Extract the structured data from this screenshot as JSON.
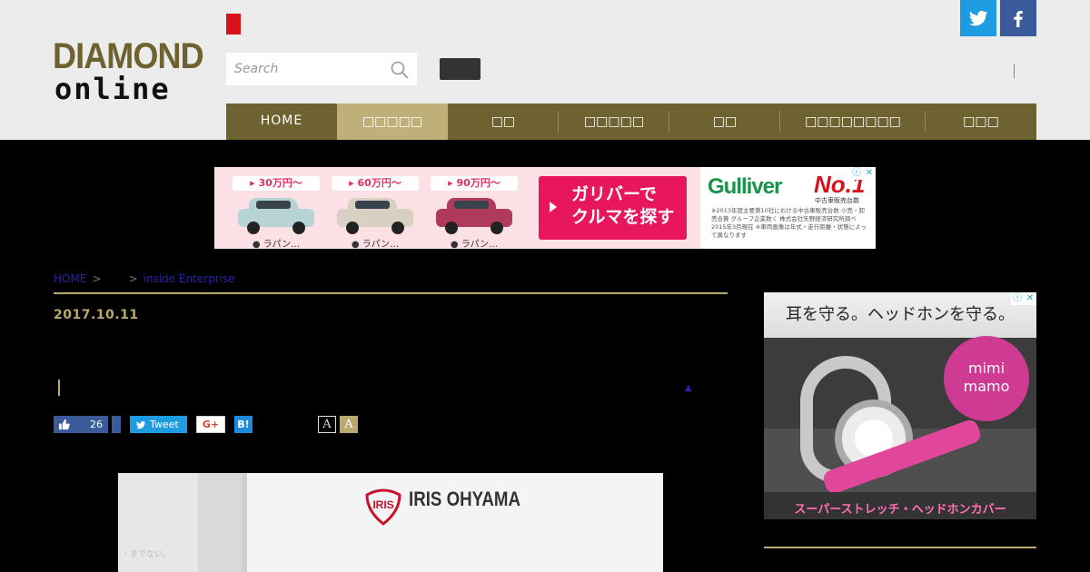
{
  "header": {
    "logo_line1": "DIAMOND",
    "logo_line2": "online",
    "search_placeholder": "Search"
  },
  "nav": {
    "items": [
      {
        "label": "HOME"
      },
      {
        "label": "□□□□□"
      },
      {
        "label": "□□"
      },
      {
        "label": "□□□□□"
      },
      {
        "label": "□□"
      },
      {
        "label": "□□□□□□□□"
      },
      {
        "label": "□□□"
      }
    ],
    "active_index": 1
  },
  "banner_ad": {
    "cars": [
      {
        "price": "▸ 30万円～",
        "caption": "● ラパン…",
        "color": "#b7d3d6"
      },
      {
        "price": "▸ 60万円～",
        "caption": "● ラパン…",
        "color": "#d9d0c4"
      },
      {
        "price": "▸ 90万円～",
        "caption": "● ラパン…",
        "color": "#b03a5c"
      }
    ],
    "cta_line1": "ガリバーで",
    "cta_line2": "クルマを探す",
    "brand": "Gulliver",
    "badge": "No.1",
    "badge_sub": "中古車販売台数",
    "fine_print": "※2013年度主要第10社における中古車販売台数 小売・卸売合算 グループ企業数く 株式会社矢野経済研究所調べ 2015年3月現在 ※車両画像は年式・走行距離・状態によって異なります"
  },
  "breadcrumb": {
    "home": "HOME",
    "sep": ">",
    "category": "",
    "section": "inside Enterprise"
  },
  "article": {
    "date": "2017.10.11",
    "like_count": "26",
    "tweet_label": "Tweet",
    "gplus_label": "G+",
    "hatena_label": "B!",
    "font_small": "A",
    "font_large": "A",
    "photo_brand": "IRIS OHYAMA",
    "photo_caption": "・までない。"
  },
  "side_ad": {
    "headline": "耳を守る。ヘッドホンを守る。",
    "brand_line1": "mimi",
    "brand_line2": "mamo",
    "footer": "スーパーストレッチ・ヘッドホンカバー"
  },
  "colors": {
    "brand_gold": "#6d6230",
    "nav_active": "#bfaf78",
    "accent_rule": "#b9a96e",
    "twitter": "#1d9ce2",
    "facebook": "#3a5a99"
  }
}
